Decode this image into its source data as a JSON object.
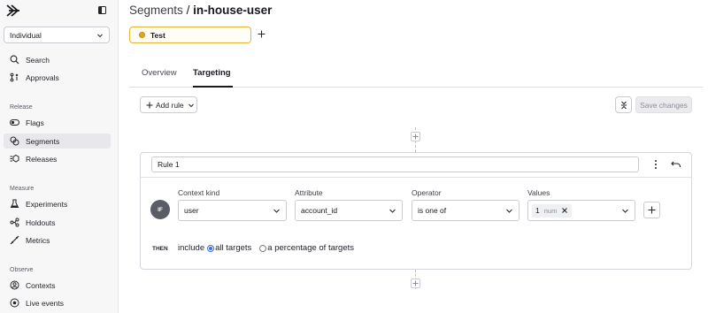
{
  "sidebar": {
    "project": "Individual",
    "top_items": [
      {
        "label": "Search",
        "icon": "search-icon"
      },
      {
        "label": "Approvals",
        "icon": "approvals-icon"
      }
    ],
    "sections": [
      {
        "title": "Release",
        "items": [
          {
            "label": "Flags",
            "icon": "toggle-icon"
          },
          {
            "label": "Segments",
            "icon": "segments-icon",
            "active": true
          },
          {
            "label": "Releases",
            "icon": "releases-icon"
          }
        ]
      },
      {
        "title": "Measure",
        "items": [
          {
            "label": "Experiments",
            "icon": "flask-icon"
          },
          {
            "label": "Holdouts",
            "icon": "holdouts-icon"
          },
          {
            "label": "Metrics",
            "icon": "metrics-icon"
          }
        ]
      },
      {
        "title": "Observe",
        "items": [
          {
            "label": "Contexts",
            "icon": "contexts-icon"
          },
          {
            "label": "Live events",
            "icon": "live-events-icon"
          }
        ]
      }
    ]
  },
  "header": {
    "breadcrumb_parent": "Segments",
    "separator": "/",
    "current": "in-house-user"
  },
  "environment": {
    "name": "Test",
    "color": "#e8a317"
  },
  "tabs": [
    {
      "label": "Overview",
      "active": false
    },
    {
      "label": "Targeting",
      "active": true
    }
  ],
  "toolbar": {
    "add_rule_label": "Add rule",
    "save_label": "Save changes"
  },
  "rule": {
    "name": "Rule 1",
    "if_label": "IF",
    "fields": {
      "context_kind": {
        "label": "Context kind",
        "value": "user"
      },
      "attribute": {
        "label": "Attribute",
        "value": "account_id"
      },
      "operator": {
        "label": "Operator",
        "value": "is one of"
      },
      "values": {
        "label": "Values",
        "chip_value": "1",
        "chip_type": "num"
      }
    },
    "then": {
      "label": "THEN",
      "include_label": "include",
      "option_all": "all targets",
      "option_percentage": "a percentage of targets",
      "selected": "all"
    }
  },
  "colors": {
    "accent": "#3b6fe0",
    "env_border": "#e6b537"
  }
}
